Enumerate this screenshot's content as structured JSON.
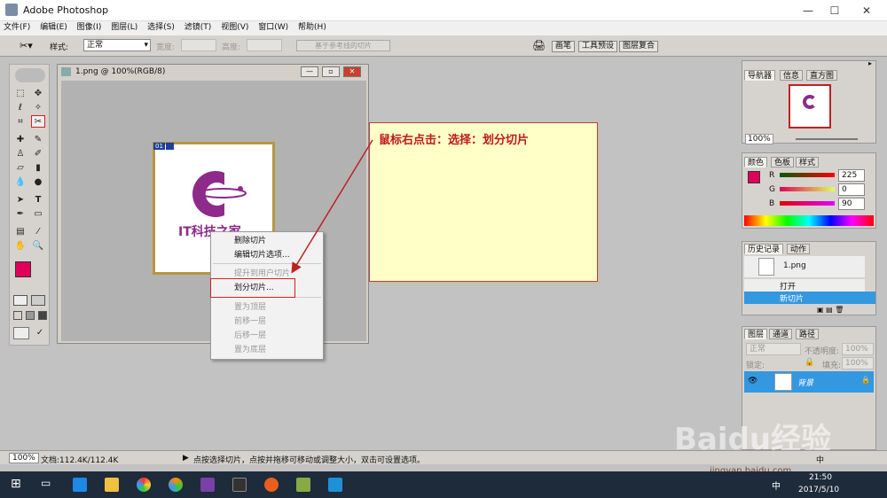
{
  "window": {
    "title": "Adobe Photoshop",
    "min": "—",
    "max": "☐",
    "close": "✕"
  },
  "menu": [
    "文件(F)",
    "编辑(E)",
    "图像(I)",
    "图层(L)",
    "选择(S)",
    "滤镜(T)",
    "视图(V)",
    "窗口(W)",
    "帮助(H)"
  ],
  "options": {
    "style_label": "样式:",
    "style_value": "正常",
    "width_label": "宽度:",
    "height_label": "高度:",
    "slice_btn": "基于参考线的切片",
    "tabs": [
      "画笔",
      "工具预设",
      "图层复合"
    ]
  },
  "doc": {
    "title": "1.png @ 100%(RGB/8)",
    "slice_tag": "01"
  },
  "logo": {
    "text": "IT科技之家",
    "brand_color": "#8e2a8a"
  },
  "context_menu": [
    {
      "label": "删除切片",
      "enabled": true
    },
    {
      "label": "编辑切片选项...",
      "enabled": true
    },
    {
      "label": "提升到用户切片",
      "enabled": false
    },
    {
      "label": "划分切片...",
      "enabled": true
    },
    {
      "label": "置为顶层",
      "enabled": false
    },
    {
      "label": "前移一层",
      "enabled": false
    },
    {
      "label": "后移一层",
      "enabled": false
    },
    {
      "label": "置为底层",
      "enabled": false
    }
  ],
  "note": {
    "text": "鼠标右点击：选择：划分切片",
    "color": "#c01818"
  },
  "navigator": {
    "tabs": [
      "导航器",
      "信息",
      "直方图"
    ],
    "zoom": "100%"
  },
  "color": {
    "tabs": [
      "颜色",
      "色板",
      "样式"
    ],
    "r_label": "R",
    "g_label": "G",
    "b_label": "B",
    "r": "225",
    "g": "0",
    "b": "90",
    "swatch": "#e1005a"
  },
  "history": {
    "tabs": [
      "历史记录",
      "动作"
    ],
    "snapshot": "1.png",
    "items": [
      "打开",
      "新切片"
    ]
  },
  "layers": {
    "tabs": [
      "图层",
      "通道",
      "路径"
    ],
    "blend": "正常",
    "opacity_label": "不透明度:",
    "opacity": "100%",
    "lock_label": "锁定:",
    "fill_label": "填充:",
    "fill": "100%",
    "layer_name": "背景"
  },
  "status": {
    "zoom": "100%",
    "doc": "文档:112.4K/112.4K",
    "hint": "点按选择切片，点按并拖移可移动或调整大小，双击可设置选项。"
  },
  "taskbar": {
    "time": "21:50",
    "date": "2017/5/10",
    "ime": "中"
  },
  "watermark": {
    "text": "Baidu经验",
    "sub": "jingyan.baidu.com"
  }
}
